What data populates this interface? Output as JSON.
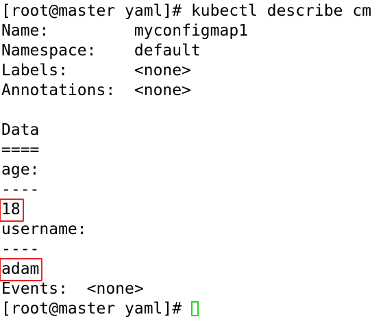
{
  "prompt": "[root@master yaml]# ",
  "command": "kubectl describe cm",
  "fields": [
    {
      "key": "Name:         ",
      "value": "myconfigmap1"
    },
    {
      "key": "Namespace:    ",
      "value": "default"
    },
    {
      "key": "Labels:       ",
      "value": "<none>"
    },
    {
      "key": "Annotations:  ",
      "value": "<none>"
    }
  ],
  "data_header": "Data",
  "data_rule": "====",
  "entries": [
    {
      "key": "age:",
      "rule": "----",
      "value": "18"
    },
    {
      "key": "username:",
      "rule": "----",
      "value": "adam"
    }
  ],
  "events": {
    "key": "Events:  ",
    "value": "<none>"
  },
  "highlight_color": "#e8231f",
  "cursor_color": "#22d922"
}
